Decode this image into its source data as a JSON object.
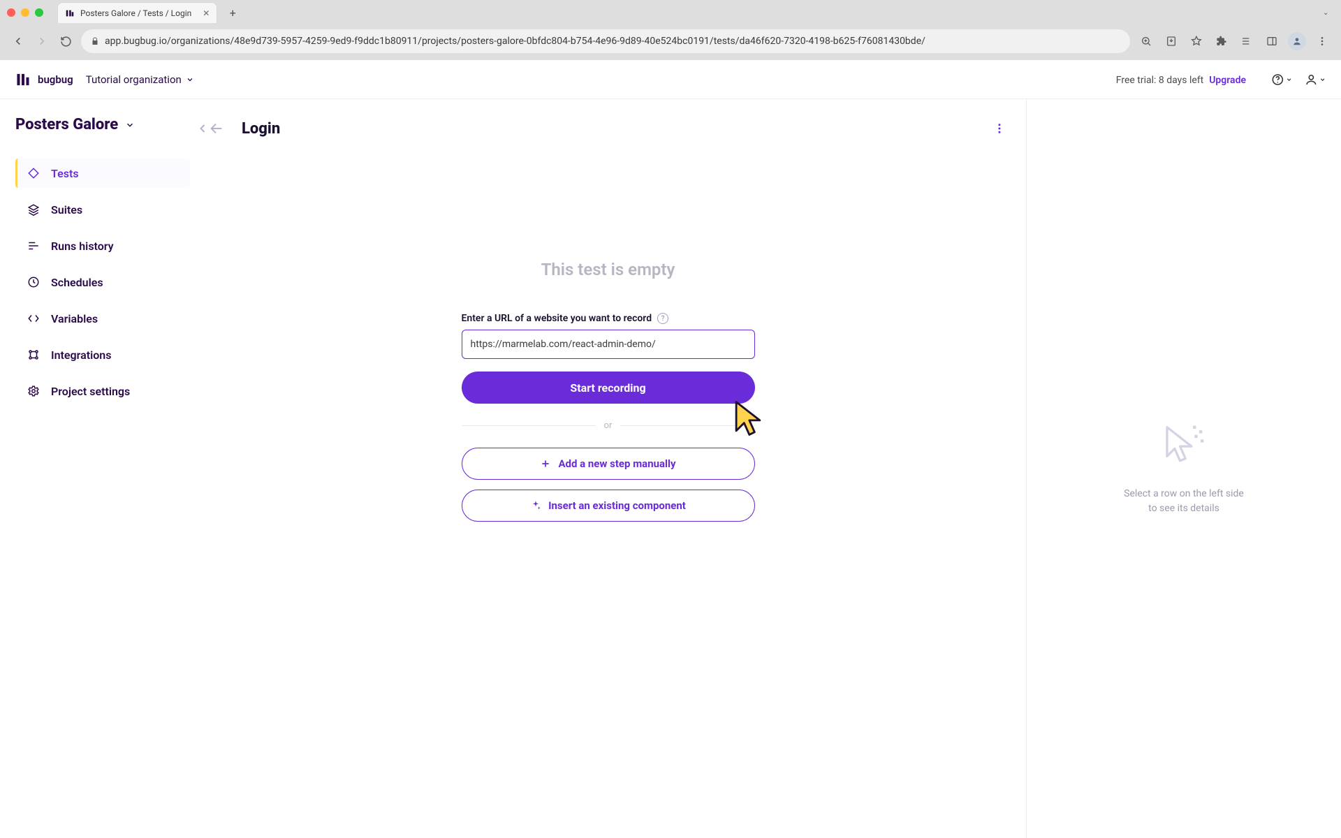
{
  "browser": {
    "tab_title": "Posters Galore / Tests / Login",
    "url": "app.bugbug.io/organizations/48e9d739-5957-4259-9ed9-f9ddc1b80911/projects/posters-galore-0bfdc804-b754-4e96-9d89-40e524bc0191/tests/da46f620-7320-4198-b625-f76081430bde/"
  },
  "header": {
    "brand": "bugbug",
    "org_label": "Tutorial organization",
    "trial_text": "Free trial: 8 days left",
    "upgrade_label": "Upgrade"
  },
  "project": {
    "name": "Posters Galore",
    "page_title": "Login"
  },
  "sidebar": {
    "items": [
      {
        "label": "Tests",
        "icon": "diamond-icon",
        "active": true
      },
      {
        "label": "Suites",
        "icon": "layers-icon",
        "active": false
      },
      {
        "label": "Runs history",
        "icon": "runs-icon",
        "active": false
      },
      {
        "label": "Schedules",
        "icon": "clock-icon",
        "active": false
      },
      {
        "label": "Variables",
        "icon": "code-icon",
        "active": false
      },
      {
        "label": "Integrations",
        "icon": "integrations-icon",
        "active": false
      },
      {
        "label": "Project settings",
        "icon": "gear-icon",
        "active": false
      }
    ]
  },
  "main": {
    "empty_title": "This test is empty",
    "url_field_label": "Enter a URL of a website you want to record",
    "url_value": "https://marmelab.com/react-admin-demo/",
    "start_recording_label": "Start recording",
    "or_label": "or",
    "add_step_label": "Add a new step manually",
    "insert_component_label": "Insert an existing component"
  },
  "detail_panel": {
    "placeholder_line1": "Select a row on the left side",
    "placeholder_line2": "to see its details"
  }
}
